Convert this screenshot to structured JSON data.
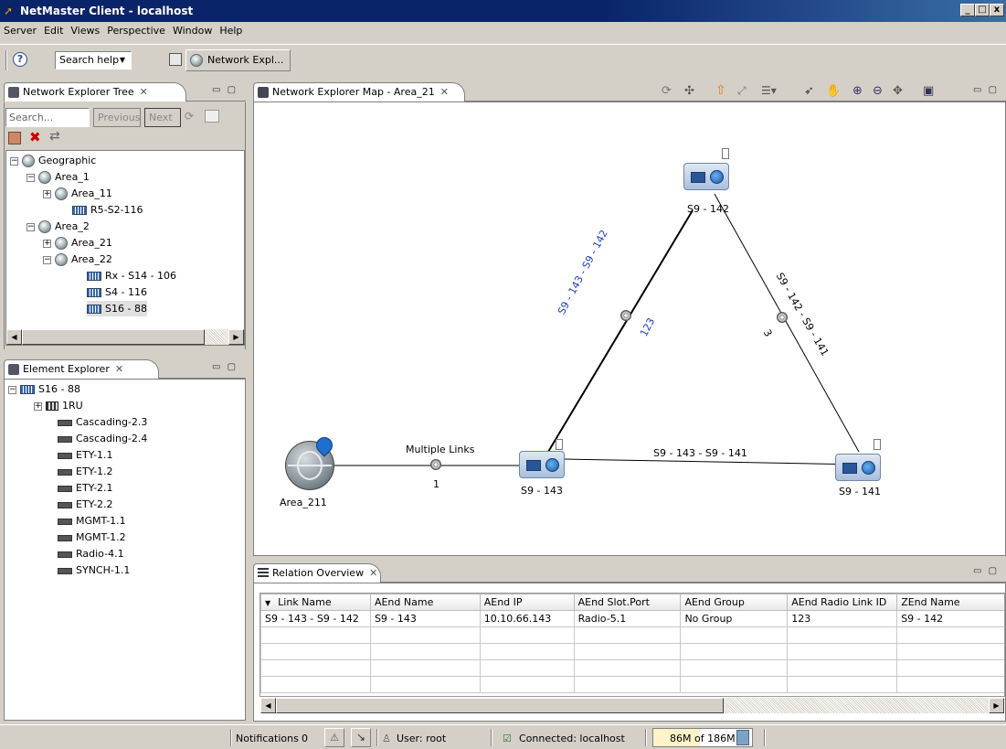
{
  "window": {
    "title": "NetMaster Client - localhost"
  },
  "menu": [
    "Server",
    "Edit",
    "Views",
    "Perspective",
    "Window",
    "Help"
  ],
  "toolbar": {
    "search_help": "Search help",
    "perspective_label": "Network Expl..."
  },
  "tree_view": {
    "tab_label": "Network Explorer Tree",
    "search_placeholder": "Search...",
    "previous_label": "Previous",
    "next_label": "Next",
    "items": [
      {
        "label": "Geographic"
      },
      {
        "label": "Area_1"
      },
      {
        "label": "Area_11"
      },
      {
        "label": "R5-S2-116"
      },
      {
        "label": "Area_2"
      },
      {
        "label": "Area_21"
      },
      {
        "label": "Area_22"
      },
      {
        "label": "Rx - S14 - 106"
      },
      {
        "label": "S4 - 116"
      },
      {
        "label": "S16 - 88"
      }
    ]
  },
  "element_explorer": {
    "tab_label": "Element Explorer",
    "items": [
      {
        "label": "S16 - 88"
      },
      {
        "label": "1RU"
      },
      {
        "label": "Cascading-2.3"
      },
      {
        "label": "Cascading-2.4"
      },
      {
        "label": "ETY-1.1"
      },
      {
        "label": "ETY-1.2"
      },
      {
        "label": "ETY-2.1"
      },
      {
        "label": "ETY-2.2"
      },
      {
        "label": "MGMT-1.1"
      },
      {
        "label": "MGMT-1.2"
      },
      {
        "label": "Radio-4.1"
      },
      {
        "label": "SYNCH-1.1"
      }
    ]
  },
  "map": {
    "tab_label": "Network Explorer Map - Area_21",
    "nodes": {
      "s9_142": "S9 - 142",
      "s9_143": "S9 - 143",
      "s9_141": "S9 - 141",
      "area_211": "Area_211"
    },
    "links": {
      "multi_label": "Multiple Links",
      "multi_count": "1",
      "link_143_141": "S9 - 143 - S9 - 141",
      "link_143_142": "S9 - 143 - S9 - 142",
      "link_143_142_id": "123",
      "link_142_141": "S9 - 142 - S9 - 141",
      "link_142_141_id": "3"
    }
  },
  "relation": {
    "tab_label": "Relation Overview",
    "columns": [
      "Link Name",
      "AEnd Name",
      "AEnd IP",
      "AEnd Slot.Port",
      "AEnd Group",
      "AEnd Radio Link ID",
      "ZEnd Name"
    ],
    "rows": [
      [
        "S9 - 143 - S9 - 142",
        "S9 - 143",
        "10.10.66.143",
        "Radio-5.1",
        "No Group",
        "123",
        "S9 - 142"
      ]
    ]
  },
  "status": {
    "notifications_label": "Notifications",
    "notifications_count": "0",
    "user": "User: root",
    "connected": "Connected: localhost",
    "memory": "86M of 186M"
  },
  "colors": {
    "link_label_blue": "#1a3cc8",
    "titlebar": "#0a246a"
  }
}
